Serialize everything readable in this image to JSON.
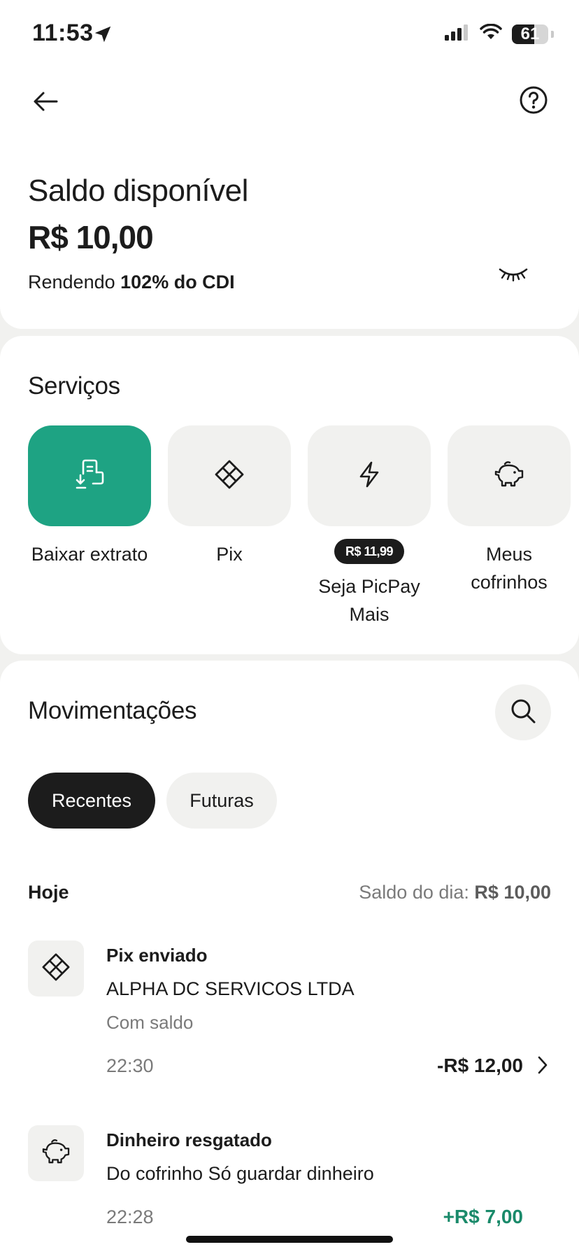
{
  "status_bar": {
    "time": "11:53",
    "battery": "61"
  },
  "header": {
    "back_icon": "arrow-left-icon",
    "help_icon": "question-circle-icon"
  },
  "balance": {
    "title": "Saldo disponível",
    "value": "R$ 10,00",
    "yield_prefix": "Rendendo",
    "yield_rate": "102% do CDI",
    "visibility_icon": "eye-closed-icon"
  },
  "services": {
    "title": "Serviços",
    "items": [
      {
        "label": "Baixar extrato",
        "icon": "download-statement-icon",
        "accent": "#1ea383"
      },
      {
        "label": "Pix",
        "icon": "pix-icon"
      },
      {
        "label": "Seja PicPay Mais",
        "icon": "lightning-icon",
        "badge": "R$ 11,99"
      },
      {
        "label": "Meus cofrinhos",
        "icon": "piggy-bank-icon"
      }
    ]
  },
  "movements": {
    "title": "Movimentações",
    "search_icon": "search-icon",
    "tabs": [
      "Recentes",
      "Futuras"
    ],
    "active_tab": "Recentes",
    "day": {
      "label": "Hoje",
      "balance_label": "Saldo do dia:",
      "balance_value": "R$ 10,00"
    },
    "transactions": [
      {
        "icon": "pix-icon",
        "title": "Pix enviado",
        "line": "ALPHA DC SERVICOS LTDA",
        "sub": "Com saldo",
        "time": "22:30",
        "amount": "-R$ 12,00",
        "color": "#1c1c1c"
      },
      {
        "icon": "piggy-bank-icon",
        "title": "Dinheiro resgatado",
        "line": "Do cofrinho Só guardar dinheiro",
        "time": "22:28",
        "amount": "+R$ 7,00",
        "color": "#1a8a6a"
      }
    ]
  }
}
